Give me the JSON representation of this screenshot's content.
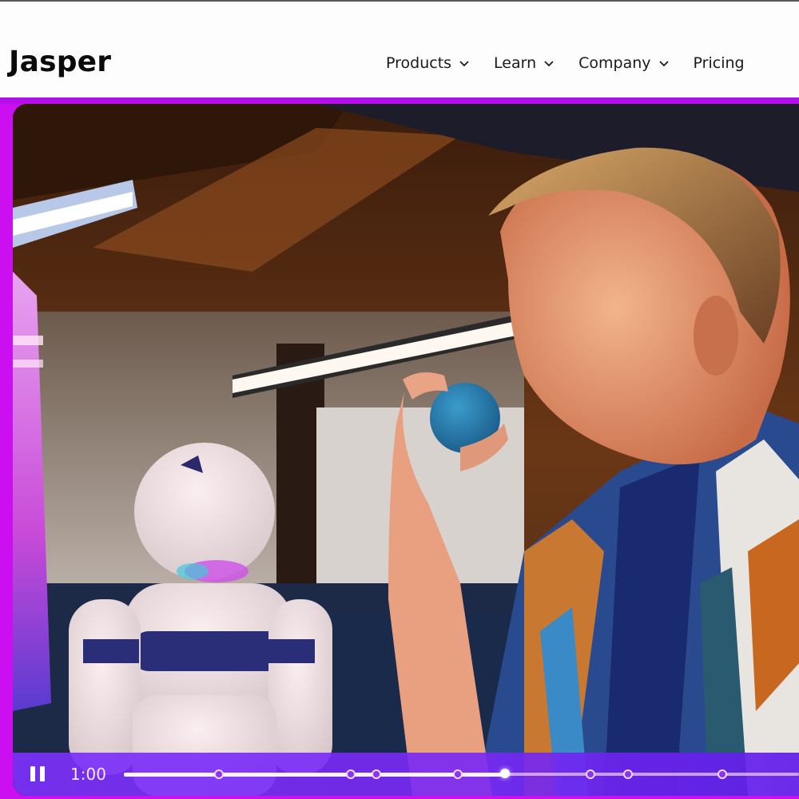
{
  "header": {
    "logo": "Jasper",
    "nav": [
      {
        "label": "Products",
        "has_dropdown": true
      },
      {
        "label": "Learn",
        "has_dropdown": true
      },
      {
        "label": "Company",
        "has_dropdown": true
      },
      {
        "label": "Pricing",
        "has_dropdown": false
      }
    ]
  },
  "video": {
    "description": "Person smiling holding a blue stress ball in an office with a white toy robot in the foreground",
    "state": "playing",
    "pause_icon": "pause-icon",
    "current_time": "1:00",
    "progress_fraction": 0.565,
    "chapter_markers": [
      0.141,
      0.336,
      0.374,
      0.495,
      0.691,
      0.747,
      0.886
    ]
  },
  "colors": {
    "frame_accent": "#cc0ff0",
    "controls_bg": "#7c30fa",
    "progress_fill": "#ffffff"
  }
}
